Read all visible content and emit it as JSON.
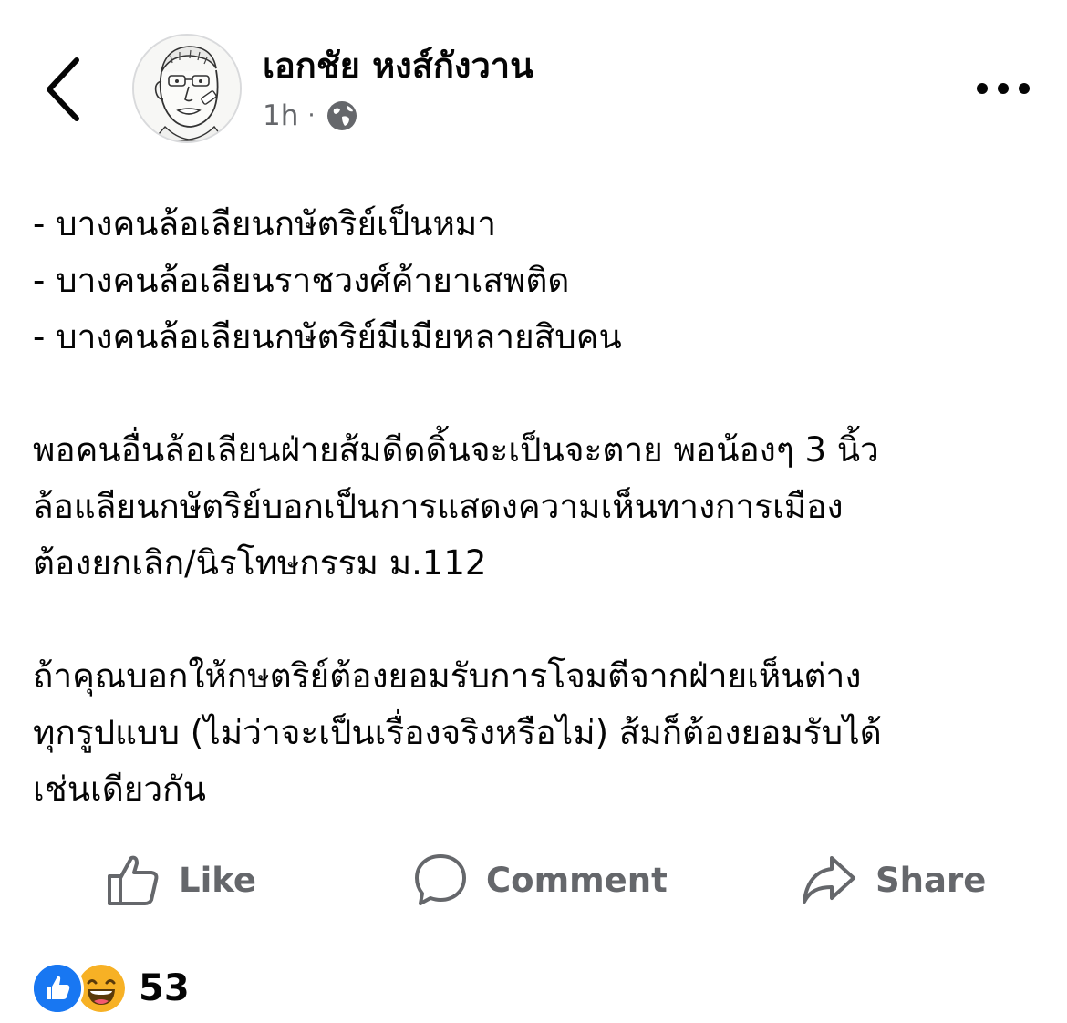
{
  "header": {
    "back_icon": "chevron-left-icon",
    "author_name": "เอกชัย หงส์กังวาน",
    "timestamp": "1h",
    "separator": "·",
    "privacy_icon": "globe-icon",
    "more_icon": "more-dots-icon"
  },
  "post": {
    "paragraphs": [
      [
        "- บางคนล้อเลียนกษัตริย์เป็นหมา",
        "- บางคนล้อเลียนราชวงศ์ค้ายาเสพติด",
        "- บางคนล้อเลียนกษัตริย์มีเมียหลายสิบคน"
      ],
      [
        "พอคนอื่นล้อเลียนฝ่ายส้มดีดดิ้นจะเป็นจะตาย พอน้องๆ 3 นิ้ว",
        "ล้อแลียนกษัตริย์บอกเป็นการแสดงความเห็นทางการเมือง",
        "ต้องยกเลิก/นิรโทษกรรม ม.112"
      ],
      [
        "ถ้าคุณบอกให้กษตริย์ต้องยอมรับการโจมตีจากฝ่ายเห็นต่าง",
        "ทุกรูปแบบ (ไม่ว่าจะเป็นเรื่องจริงหรือไม่) ส้มก็ต้องยอมรับได้",
        "เช่นเดียวกัน"
      ]
    ]
  },
  "actions": {
    "like_label": "Like",
    "comment_label": "Comment",
    "share_label": "Share"
  },
  "reactions": {
    "icons": [
      "like-reaction-icon",
      "haha-reaction-icon"
    ],
    "count": "53"
  },
  "colors": {
    "text": "#050505",
    "secondary": "#65676b",
    "like_blue": "#1877f2",
    "haha_yellow": "#f7b125"
  }
}
